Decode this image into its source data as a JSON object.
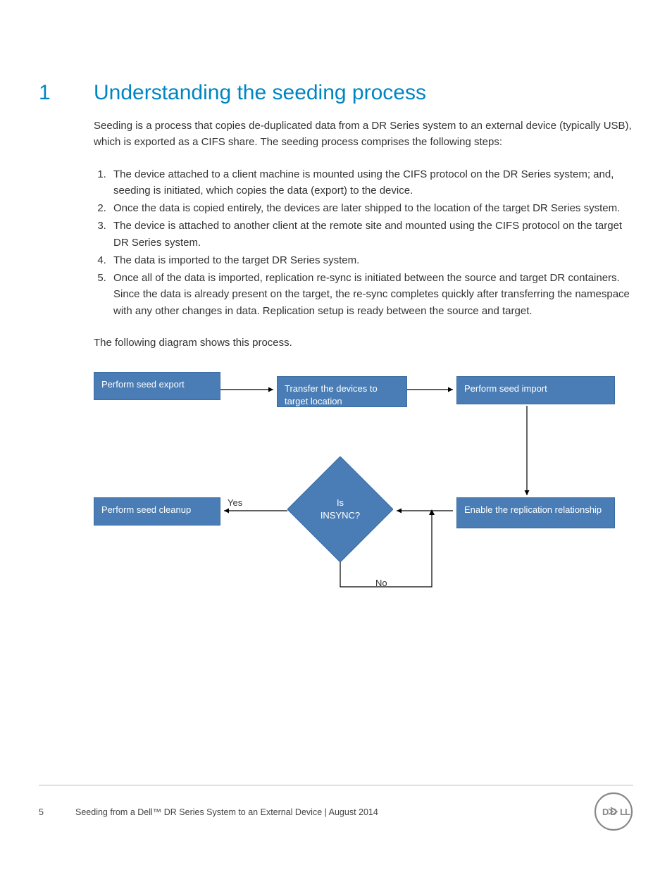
{
  "section": {
    "number": "1",
    "title": "Understanding the seeding process"
  },
  "intro": "Seeding is a process that copies de-duplicated data from a DR Series system to an external device (typically USB), which is exported as a CIFS share. The seeding process comprises the following steps:",
  "steps": [
    "The device attached to a client machine is mounted using the CIFS protocol on the DR Series system; and, seeding is initiated, which copies the data (export) to the device.",
    "Once the data is copied entirely, the devices are later shipped to the location of the target DR Series system.",
    "The device is attached to another client at the remote site and mounted using the CIFS protocol on the target DR Series system.",
    "The data is imported to the target DR Series system.",
    "Once all of the data is imported, replication re-sync is initiated between the source and target DR containers. Since the data is already present on the target, the re-sync completes quickly after transferring the namespace with any other changes in data. Replication setup is ready between the source and target."
  ],
  "diagram_caption": "The following diagram shows this process.",
  "flow": {
    "box_export": "Perform seed export",
    "box_transfer": "Transfer the devices to target location",
    "box_import": "Perform seed import",
    "box_enable": "Enable the replication relationship",
    "box_cleanup": "Perform seed cleanup",
    "decision_line1": "Is",
    "decision_line2": "INSYNC?",
    "label_yes": "Yes",
    "label_no": "No"
  },
  "footer": {
    "page": "5",
    "text": "Seeding from a Dell™ DR Series System to an External Device | August 2014"
  }
}
